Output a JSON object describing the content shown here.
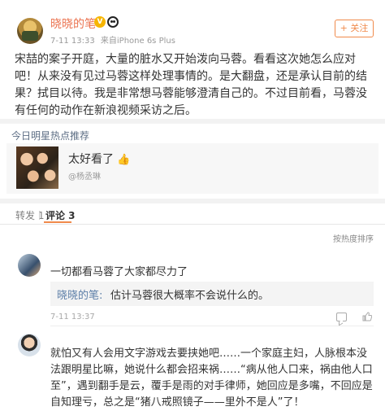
{
  "post": {
    "author": "晓晓的笔",
    "vip_badge": "V",
    "time": "7-11 13:33",
    "source": "来自iPhone 6s Plus",
    "follow_label": "+ 关注",
    "text": "宋喆的案子开庭，大量的脏水又开始泼向马蓉。看看这次她怎么应对吧！从来没有见过马蓉这样处理事情的。是大翻盘，还是承认目前的结果？拭目以待。我是非常想马蓉能够澄清自己的。不过目前看，马蓉没有任何的动作在新浪视频采访之后。"
  },
  "hot": {
    "section_title": "今日明星热点推荐",
    "headline": "太好看了",
    "headline_icon": "👍",
    "subtitle": "@杨丞琳"
  },
  "comments_section": {
    "tabs": [
      {
        "label": "转发 1"
      },
      {
        "label": "评论 3"
      }
    ],
    "sort_label": "按热度排序",
    "comments": [
      {
        "text": "一切都看马蓉了大家都尽力了",
        "reply_author": "晓晓的笔:",
        "reply_text": "估计马蓉很大概率不会说什么的。",
        "time": "7-11 13:37"
      },
      {
        "text": "就怕又有人会用文字游戏去要挟她吧……一个家庭主妇，人脉根本没法跟明星比嘛，她说什么都会招来祸……“病从他人口来，祸由他人口至”，遇到翻手是云，覆手是雨的对手律师，她回应是多嘴，不回应是自知理亏，总之是“猪八戒照镜子——里外不是人”了！"
      }
    ]
  },
  "colors": {
    "accent": "#eb7350",
    "follow": "#f08a4b",
    "link": "#5d7fa8",
    "hot_title": "#5d6e84"
  }
}
